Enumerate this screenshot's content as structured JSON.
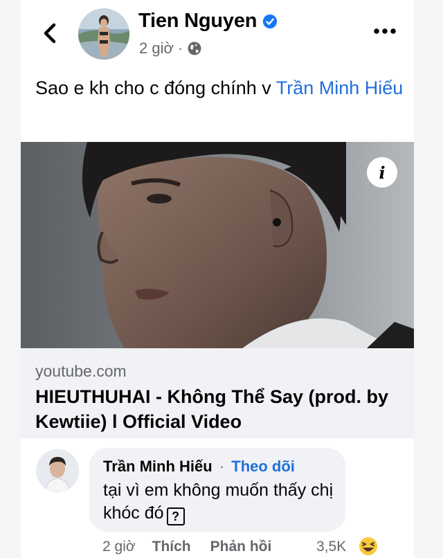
{
  "header": {
    "back_icon": "chevron-left-icon",
    "author_name": "Tien Nguyen",
    "verified_icon": "verified-badge-icon",
    "time": "2 giờ",
    "separator": "·",
    "privacy_icon": "globe-icon",
    "more_icon": "more-horizontal-icon"
  },
  "post": {
    "text": "Sao e kh cho c đóng chính v ",
    "mention": "Trần Minh Hiếu"
  },
  "link_preview": {
    "info_icon": "i",
    "domain": "youtube.com",
    "title": "HIEUTHUHAI - Không Thể Say (prod. by Kewtiie) l Official Video"
  },
  "comment": {
    "author": "Trần Minh Hiếu",
    "separator": "·",
    "follow_label": "Theo dõi",
    "text": "tại vì em không muốn thấy chị khóc đó",
    "glyph": "?",
    "time": "2 giờ",
    "like_label": "Thích",
    "reply_label": "Phản hồi",
    "reaction_count": "3,5K",
    "reaction_icon": "haha-reaction-icon"
  },
  "colors": {
    "link_blue": "#216fdb",
    "verified_blue": "#1877f2",
    "muted_text": "#65676b",
    "bubble_bg": "#f0f2f5"
  }
}
